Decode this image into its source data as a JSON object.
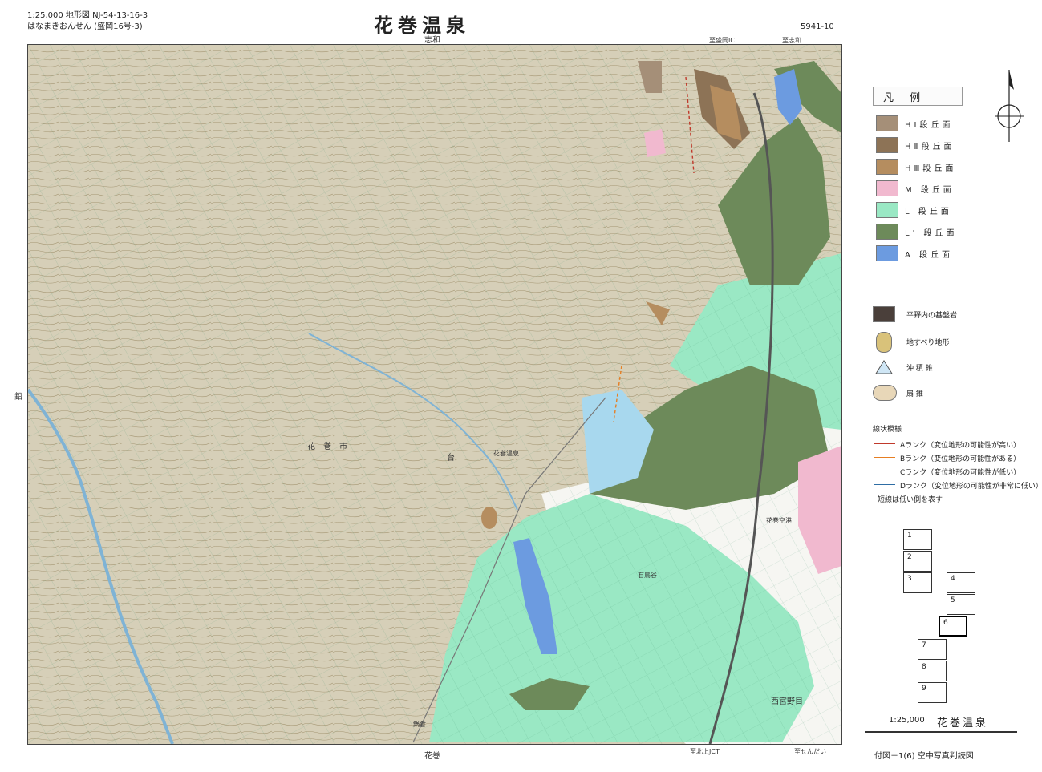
{
  "header": {
    "scale_line": "1:25,000 地形図  NJ-54-13-16-3",
    "reading_line": "はなまきおんせん  (盛岡16号-3)",
    "title": "花巻温泉",
    "sheet_code": "5941-10"
  },
  "edge_labels": {
    "top": [
      "志和",
      "至盛岡IC",
      "至志和"
    ],
    "bottom": [
      "花巻",
      "至北上JCT",
      "至せんだい"
    ],
    "left": "鉛"
  },
  "place_labels": [
    "花巻市",
    "花巻温泉",
    "台",
    "西宮野目",
    "鍋倉",
    "石鳥谷",
    "花巻空港"
  ],
  "legend": {
    "title": "凡 例",
    "terraces": [
      {
        "label": "HⅠ段丘面",
        "color": "#a58f78"
      },
      {
        "label": "HⅡ段丘面",
        "color": "#8d7356"
      },
      {
        "label": "HⅢ段丘面",
        "color": "#b58d5f"
      },
      {
        "label": "M 段丘面",
        "color": "#f1b9cf"
      },
      {
        "label": "L 段丘面",
        "color": "#9ae8c4"
      },
      {
        "label": "L' 段丘面",
        "color": "#6d8a5a"
      },
      {
        "label": "A 段丘面",
        "color": "#6c9be0"
      }
    ],
    "features": [
      {
        "label": "平野内の基盤岩",
        "icon": "bedrock-swatch"
      },
      {
        "label": "地すべり地形",
        "icon": "landslide-icon"
      },
      {
        "label": "沖 積 錐",
        "icon": "alluvial-cone-icon"
      },
      {
        "label": "扇   錐",
        "icon": "fan-icon"
      }
    ],
    "lines_title": "線状模様",
    "lines": [
      {
        "label": "Aランク（変位地形の可能性が高い）",
        "color": "#c0392b"
      },
      {
        "label": "Bランク（変位地形の可能性がある）",
        "color": "#e67e22"
      },
      {
        "label": "Cランク（変位地形の可能性が低い）",
        "color": "#222222"
      },
      {
        "label": "Dランク（変位地形の可能性が非常に低い）",
        "color": "#2e6da4"
      }
    ],
    "lines_note": "短線は低い側を表す"
  },
  "index_map": {
    "cells": [
      "1",
      "2",
      "3",
      "4",
      "5",
      "6",
      "7",
      "8",
      "9"
    ],
    "current": "6"
  },
  "footer": {
    "scale": "1:25,000",
    "name": "花巻温泉",
    "caption": "付図－1(6) 空中写真判読図"
  }
}
